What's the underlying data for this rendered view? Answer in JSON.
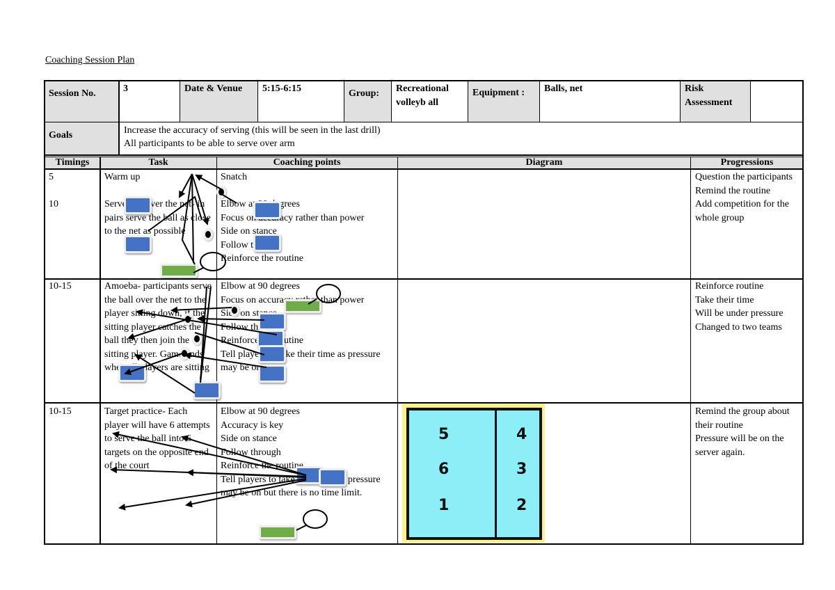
{
  "document": {
    "title": "Coaching Session Plan"
  },
  "header": {
    "session_no_label": "Session No.",
    "session_no_value": "3",
    "date_venue_label": "Date & Venue",
    "time_value": "5:15-6:15",
    "group_label": "Group:",
    "group_value": "Recreational volleyb all",
    "equipment_label": "Equipment :",
    "equipment_value": "Balls, net",
    "risk_label": "Risk Assessment",
    "risk_value": ""
  },
  "goals": {
    "label": "Goals",
    "lines": [
      "Increase the accuracy of serving (this will be seen in the last drill)",
      "All participants to be able to serve over arm"
    ]
  },
  "columns": {
    "timings": "Timings",
    "task": "Task",
    "coaching_points": "Coaching points",
    "diagram": "Diagram",
    "progressions": "Progressions"
  },
  "rows": [
    {
      "timings": "5\n\n10",
      "task": "Warm up\n\nServe just over the net- in pairs serve the ball as close to the net as possible",
      "coaching_points": "Snatch\n\nElbow at 90 degrees\nFocus on accuracy rather than power\nSide on stance\nFollow through\nReinforce the routine",
      "progressions": "Question the participants\nRemind the routine\nAdd competition for the whole group"
    },
    {
      "timings": "10-15",
      "task": "Amoeba- participants serve the ball over the net to the player sitting down, if the sitting player catches the ball they then join the sitting player. Game ends when all players are sitting",
      "coaching_points": " Elbow at 90 degrees\nFocus on accuracy rather than power\nSide on stance\nFollow through\nReinforce the routine\nTell players to take their time as pressure may be on",
      "progressions": "Reinforce routine\nTake their time\nWill be under pressure\nChanged to two teams"
    },
    {
      "timings": "10-15",
      "task": "Target practice- Each player will have 6 attempts to serve the ball into 6 targets on the opposite end of the court",
      "coaching_points": " Elbow at 90 degrees\nAccuracy is key\nSide on stance\nFollow through\nReinforce the routine\nTell players to take their time as pressure may be on but there is no time limit.",
      "progressions": "Remind the group about their routine\nPressure will be on the server again."
    }
  ],
  "court_diagram": {
    "left_column": [
      "5",
      "6",
      "1"
    ],
    "right_column": [
      "4",
      "3",
      "2"
    ],
    "colors": {
      "court": "#8ceff7",
      "border": "#111111",
      "frame": "#fbf28c"
    }
  },
  "annotation_colors": {
    "blue_marker": "#4472c4",
    "green_marker": "#70ad47"
  }
}
